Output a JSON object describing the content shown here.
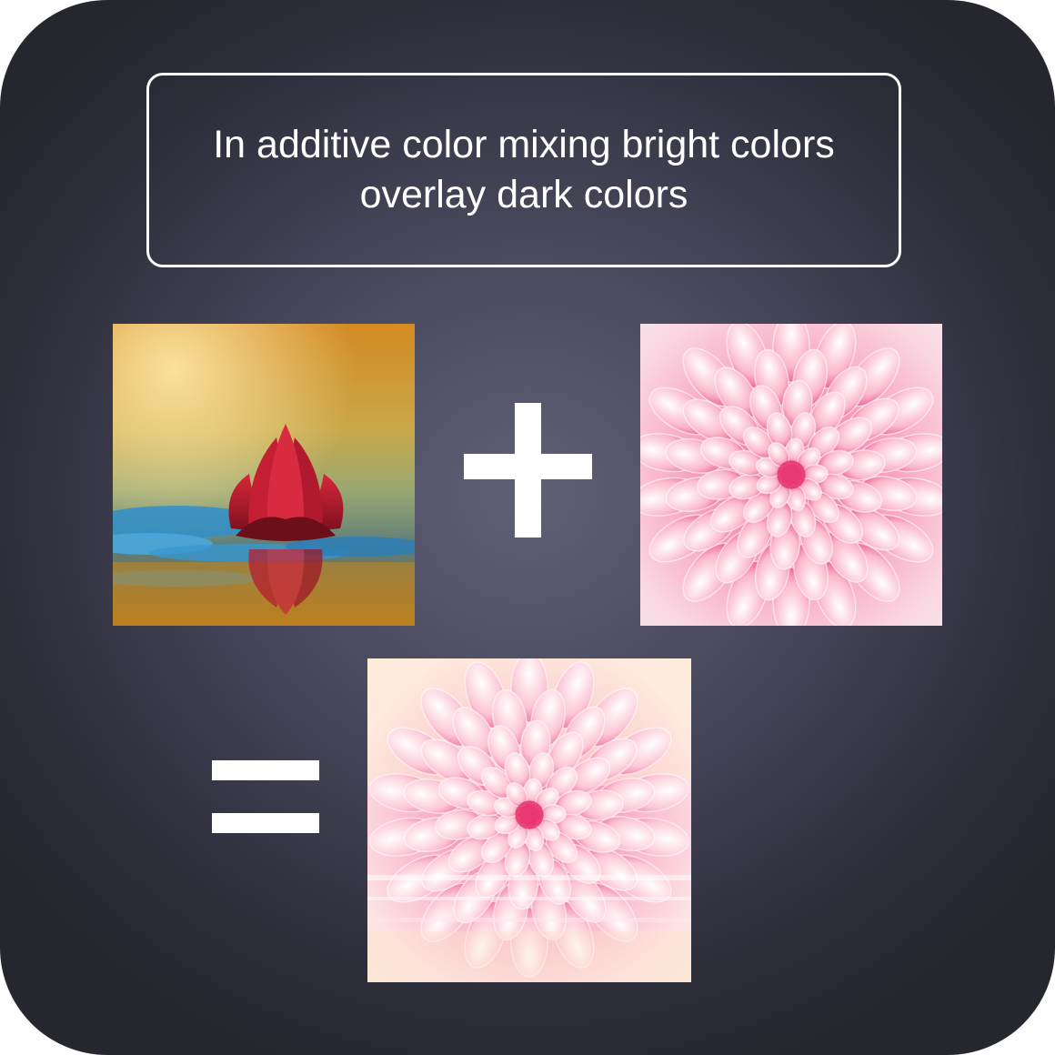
{
  "caption": {
    "line1": "In additive color mixing bright colors",
    "line2": "overlay dark colors"
  },
  "images": [
    {
      "name": "water-lily-photo",
      "subject": "red water lily on blue water with golden background"
    },
    {
      "name": "dahlia-photo",
      "subject": "pink dahlia flower close-up"
    },
    {
      "name": "blended-result-photo",
      "subject": "additive blend of the water lily and dahlia"
    }
  ],
  "operators": {
    "plus": "plus-sign",
    "equals": "equals-sign"
  },
  "colors": {
    "background": "#4a4a5e",
    "caption_border": "#ffffff",
    "caption_text": "#ffffff",
    "operators": "#ffffff"
  }
}
